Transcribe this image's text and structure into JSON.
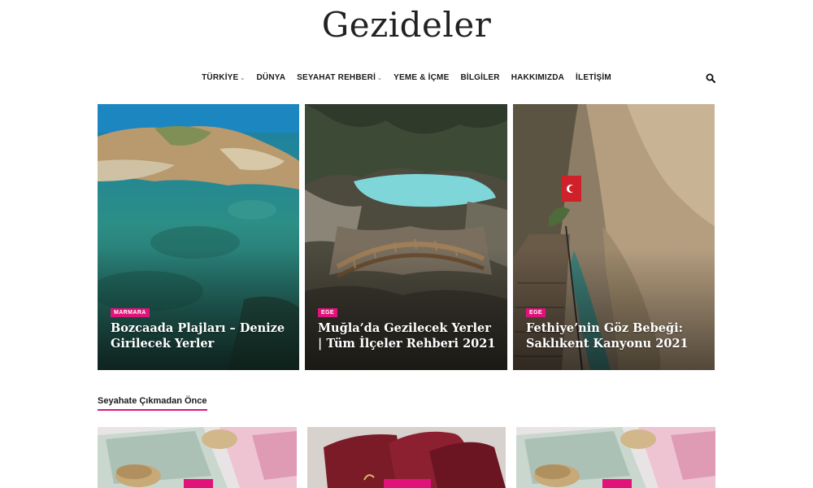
{
  "site": {
    "logo": "Gezideler"
  },
  "nav": {
    "items": [
      {
        "label": "TÜRKİYE",
        "dropdown": true
      },
      {
        "label": "DÜNYA",
        "dropdown": false
      },
      {
        "label": "SEYAHAT REHBERİ",
        "dropdown": true
      },
      {
        "label": "YEME & İÇME",
        "dropdown": false
      },
      {
        "label": "BİLGİLER",
        "dropdown": false
      },
      {
        "label": "HAKKIMIZDA",
        "dropdown": false
      },
      {
        "label": "İLETİŞİM",
        "dropdown": false
      }
    ],
    "search_icon": "search-icon"
  },
  "featured": [
    {
      "category": "MARMARA",
      "title": "Bozcaada Plajları – Denize Girilecek Yerler"
    },
    {
      "category": "EGE",
      "title": "Muğla’da Gezilecek Yerler | Tüm İlçeler Rehberi 2021"
    },
    {
      "category": "EGE",
      "title": "Fethiye’nin Göz Bebeği: Saklıkent Kanyonu 2021"
    }
  ],
  "section": {
    "title": "Seyahate Çıkmadan Önce"
  },
  "colors": {
    "accent": "#e0137a",
    "text": "#1a1a1a",
    "background": "#ffffff"
  }
}
